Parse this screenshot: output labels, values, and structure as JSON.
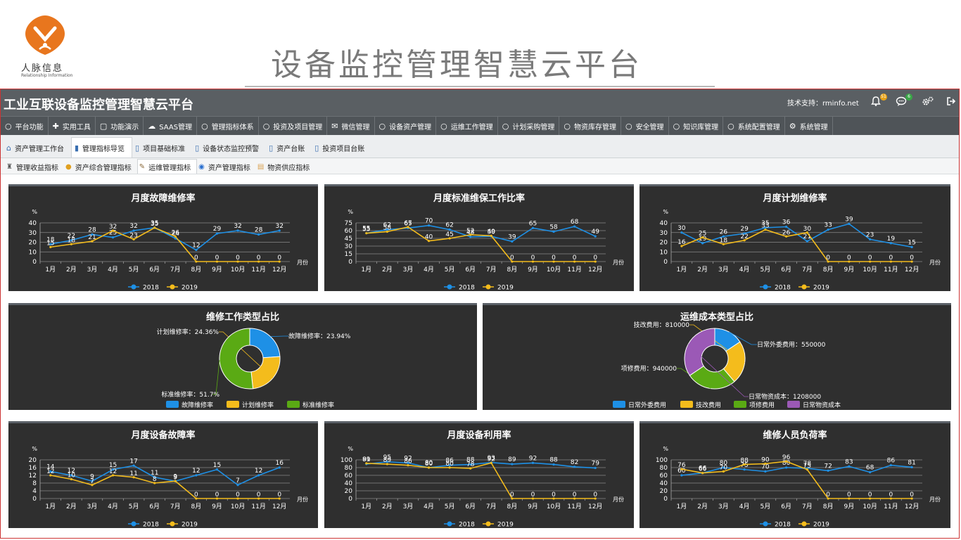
{
  "brand": {
    "name": "人脉信息",
    "sub": "Relationship Information"
  },
  "slide_title": "设备监控管理智慧云平台",
  "app": {
    "title": "工业互联设备监控管理智慧云平台",
    "support": "技术支持：rminfo.net",
    "bell_badge": "51",
    "chat_badge": "6",
    "icons": {
      "bell": "bell-icon",
      "chat": "chat-icon",
      "settings": "gear-icon",
      "logout": "logout-icon"
    }
  },
  "menu": [
    {
      "icon": "○",
      "label": "平台功能"
    },
    {
      "icon": "✚",
      "label": "实用工具"
    },
    {
      "icon": "▢",
      "label": "功能演示"
    },
    {
      "icon": "☁",
      "label": "SAAS管理"
    },
    {
      "icon": "○",
      "label": "管理指标体系"
    },
    {
      "icon": "○",
      "label": "投资及项目管理"
    },
    {
      "icon": "✉",
      "label": "微信管理"
    },
    {
      "icon": "○",
      "label": "设备资产管理"
    },
    {
      "icon": "○",
      "label": "运维工作管理"
    },
    {
      "icon": "○",
      "label": "计划采购管理"
    },
    {
      "icon": "○",
      "label": "物资库存管理"
    },
    {
      "icon": "○",
      "label": "安全管理"
    },
    {
      "icon": "○",
      "label": "知识库管理"
    },
    {
      "icon": "○",
      "label": "系统配置管理"
    },
    {
      "icon": "⚙",
      "label": "系统管理"
    }
  ],
  "tabs1": [
    {
      "icon": "⌂",
      "label": "资产管理工作台"
    },
    {
      "icon": "▮",
      "label": "管理指标导览"
    },
    {
      "icon": "▯",
      "label": "项目基础标准"
    },
    {
      "icon": "▯",
      "label": "设备状态监控预警"
    },
    {
      "icon": "▯",
      "label": "资产台账"
    },
    {
      "icon": "▯",
      "label": "投资项目台账"
    }
  ],
  "tabs2": [
    {
      "icon": "♜",
      "label": "管理收益指标"
    },
    {
      "icon": "●",
      "label": "资产综合管理指标"
    },
    {
      "icon": "✎",
      "label": "运维管理指标"
    },
    {
      "icon": "◉",
      "label": "资产管理指标"
    },
    {
      "icon": "▤",
      "label": "物资供应指标"
    }
  ],
  "chart_data": [
    {
      "type": "line",
      "title": "月度故障维修率",
      "ylabel": "%",
      "xlabel": "月份",
      "ylim": [
        0,
        40
      ],
      "yticks": [
        0,
        10,
        20,
        30,
        40
      ],
      "categories": [
        "1月",
        "2月",
        "3月",
        "4月",
        "5月",
        "6月",
        "7月",
        "8月",
        "9月",
        "10月",
        "11月",
        "12月"
      ],
      "series": [
        {
          "name": "2018",
          "values": [
            18,
            22,
            28,
            25,
            32,
            35,
            24,
            12,
            29,
            32,
            28,
            32
          ],
          "labels": [
            "18",
            "22",
            "28",
            "25",
            "32",
            "35",
            "24",
            "12",
            "29",
            "32",
            "28",
            "32"
          ]
        },
        {
          "name": "2019",
          "values": [
            15,
            18,
            21,
            32,
            23,
            35,
            26,
            0,
            0,
            0,
            0,
            0
          ],
          "labels": [
            "15",
            "18",
            "21",
            "32",
            "23",
            "35",
            "26",
            "0",
            "0",
            "0",
            "0",
            "0"
          ]
        }
      ]
    },
    {
      "type": "line",
      "title": "月度标准维保工作比率",
      "ylabel": "%",
      "xlabel": "月份",
      "ylim": [
        0,
        75
      ],
      "yticks": [
        0,
        15,
        30,
        45,
        60,
        75
      ],
      "categories": [
        "1月",
        "2月",
        "3月",
        "4月",
        "5月",
        "6月",
        "7月",
        "8月",
        "9月",
        "10月",
        "11月",
        "12月"
      ],
      "series": [
        {
          "name": "2018",
          "values": [
            55,
            62,
            65,
            70,
            62,
            48,
            49,
            39,
            65,
            58,
            68,
            49
          ],
          "labels": [
            "55",
            "62",
            "65",
            "70",
            "62",
            "48",
            "49",
            "39",
            "65",
            "58",
            "68",
            "49"
          ]
        },
        {
          "name": "2019",
          "values": [
            55,
            58,
            67,
            40,
            45,
            52,
            50,
            0,
            0,
            0,
            0,
            0
          ],
          "labels": [
            "55",
            "58",
            "67",
            "40",
            "45",
            "52",
            "50",
            "0",
            "0",
            "0",
            "0",
            "0"
          ]
        }
      ]
    },
    {
      "type": "line",
      "title": "月度计划维修率",
      "ylabel": "%",
      "xlabel": "月份",
      "ylim": [
        0,
        40
      ],
      "yticks": [
        0,
        10,
        20,
        30,
        40
      ],
      "categories": [
        "1月",
        "2月",
        "3月",
        "4月",
        "5月",
        "6月",
        "7月",
        "8月",
        "9月",
        "10月",
        "11月",
        "12月"
      ],
      "series": [
        {
          "name": "2018",
          "values": [
            30,
            19,
            26,
            29,
            35,
            36,
            21,
            33,
            39,
            23,
            19,
            15
          ],
          "labels": [
            "30",
            "19",
            "26",
            "29",
            "35",
            "36",
            "21",
            "33",
            "39",
            "23",
            "19",
            "15"
          ]
        },
        {
          "name": "2019",
          "values": [
            16,
            25,
            18,
            22,
            33,
            26,
            30,
            0,
            0,
            0,
            0,
            0
          ],
          "labels": [
            "16",
            "25",
            "18",
            "22",
            "33",
            "26",
            "30",
            "0",
            "0",
            "0",
            "0",
            "0"
          ]
        }
      ]
    },
    {
      "type": "pie",
      "title": "维修工作类型占比",
      "slices": [
        {
          "name": "故障维修率",
          "value": 23.94,
          "label": "故障维修率：23.94%",
          "color": "#1e90e6"
        },
        {
          "name": "计划维修率",
          "value": 24.36,
          "label": "计划维修率：24.36%",
          "color": "#f4bc1c"
        },
        {
          "name": "标准维修率",
          "value": 51.7,
          "label": "标准维修率：51.7%",
          "color": "#5aaa14"
        }
      ]
    },
    {
      "type": "pie",
      "title": "运维成本类型占比",
      "slices": [
        {
          "name": "日常外委费用",
          "value": 550000,
          "label": "日常外委费用：550000",
          "color": "#1e90e6"
        },
        {
          "name": "技改费用",
          "value": 810000,
          "label": "技改费用：810000",
          "color": "#f4bc1c"
        },
        {
          "name": "项修费用",
          "value": 940000,
          "label": "项修费用：940000",
          "color": "#5aaa14"
        },
        {
          "name": "日常物资成本",
          "value": 1208000,
          "label": "日常物资成本：1208000",
          "color": "#9b59b6"
        }
      ]
    },
    {
      "type": "line",
      "title": "月度设备故障率",
      "ylabel": "%",
      "xlabel": "月份",
      "ylim": [
        0,
        20
      ],
      "yticks": [
        0,
        4,
        8,
        12,
        16,
        20
      ],
      "categories": [
        "1月",
        "2月",
        "3月",
        "4月",
        "5月",
        "6月",
        "7月",
        "8月",
        "9月",
        "10月",
        "11月",
        "12月"
      ],
      "series": [
        {
          "name": "2018",
          "values": [
            14,
            12,
            9,
            15,
            17,
            11,
            9,
            12,
            15,
            7,
            12,
            16
          ],
          "labels": [
            "14",
            "12",
            "9",
            "15",
            "17",
            "11",
            "9",
            "12",
            "15",
            "7",
            "12",
            "16"
          ]
        },
        {
          "name": "2019",
          "values": [
            12,
            10,
            7,
            12,
            11,
            8,
            9,
            0,
            0,
            0,
            0,
            0
          ],
          "labels": [
            "12",
            "10",
            "7",
            "12",
            "11",
            "8",
            "9",
            "0",
            "0",
            "0",
            "0",
            "0"
          ]
        }
      ]
    },
    {
      "type": "line",
      "title": "月度设备利用率",
      "ylabel": "%",
      "xlabel": "月份",
      "ylim": [
        0,
        100
      ],
      "yticks": [
        0,
        20,
        40,
        60,
        80,
        100
      ],
      "categories": [
        "1月",
        "2月",
        "3月",
        "4月",
        "5月",
        "6月",
        "7月",
        "8月",
        "9月",
        "10月",
        "11月",
        "12月"
      ],
      "series": [
        {
          "name": "2018",
          "values": [
            89,
            95,
            92,
            80,
            86,
            88,
            93,
            89,
            92,
            88,
            82,
            79
          ],
          "labels": [
            "89",
            "95",
            "92",
            "80",
            "86",
            "88",
            "93",
            "89",
            "92",
            "88",
            "82",
            "79"
          ]
        },
        {
          "name": "2019",
          "values": [
            91,
            89,
            86,
            80,
            80,
            78,
            92,
            0,
            0,
            0,
            0,
            0
          ],
          "labels": [
            "91",
            "89",
            "86",
            "80",
            "80",
            "78",
            "92",
            "0",
            "0",
            "0",
            "0",
            "0"
          ]
        }
      ]
    },
    {
      "type": "line",
      "title": "维修人员负荷率",
      "ylabel": "%",
      "xlabel": "月份",
      "ylim": [
        0,
        100
      ],
      "yticks": [
        0,
        20,
        40,
        60,
        80,
        100
      ],
      "categories": [
        "1月",
        "2月",
        "3月",
        "4月",
        "5月",
        "6月",
        "7月",
        "8月",
        "9月",
        "10月",
        "11月",
        "12月"
      ],
      "series": [
        {
          "name": "2018",
          "values": [
            60,
            66,
            80,
            75,
            70,
            80,
            78,
            72,
            83,
            68,
            86,
            81
          ],
          "labels": [
            "60",
            "66",
            "80",
            "75",
            "70",
            "80",
            "78",
            "72",
            "83",
            "68",
            "86",
            "81"
          ]
        },
        {
          "name": "2019",
          "values": [
            76,
            66,
            70,
            88,
            90,
            96,
            75,
            0,
            0,
            0,
            0,
            0
          ],
          "labels": [
            "76",
            "66",
            "70",
            "88",
            "90",
            "96",
            "75",
            "0",
            "0",
            "0",
            "0",
            "0"
          ]
        }
      ]
    }
  ],
  "colors": {
    "series2018": "#1e90e6",
    "series2019": "#f4bc1c",
    "panel": "#2f2f2f",
    "topbar": "#5a5f63"
  }
}
